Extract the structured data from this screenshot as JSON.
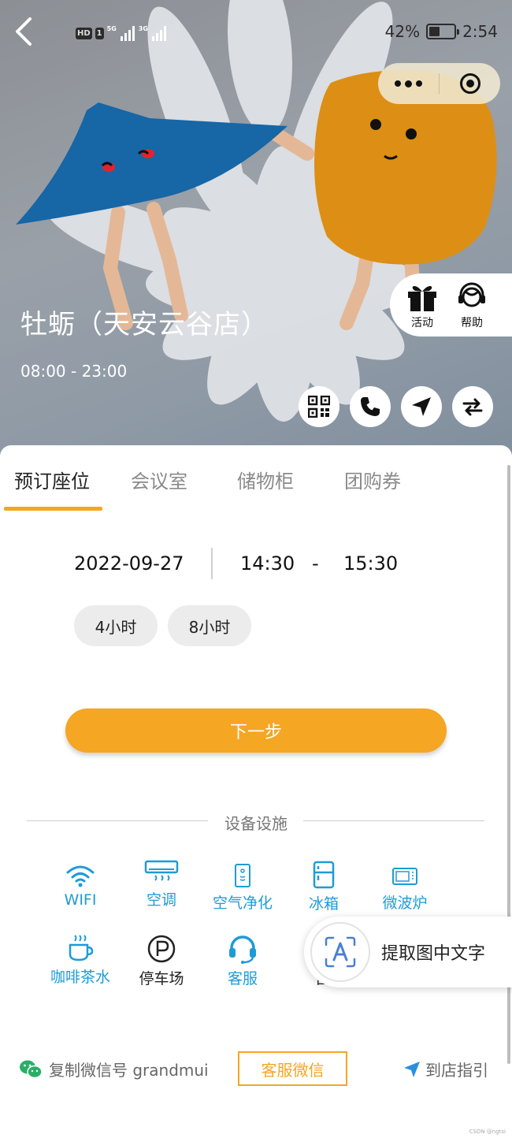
{
  "status_bar": {
    "hd_badge": "HD",
    "sim": "1",
    "net1": "5G",
    "net2": "3G",
    "battery_percent": "42%",
    "battery_level": 0.42,
    "time": "2:54"
  },
  "side_actions": [
    {
      "label": "活动",
      "icon": "gift-icon"
    },
    {
      "label": "帮助",
      "icon": "customer-service-icon"
    }
  ],
  "store": {
    "name": "牡蛎（天安云谷店）",
    "hours": "08:00 - 23:00"
  },
  "quick_actions": [
    {
      "icon": "qrcode-icon"
    },
    {
      "icon": "phone-icon"
    },
    {
      "icon": "navigate-icon"
    },
    {
      "icon": "switch-icon"
    }
  ],
  "tabs": [
    {
      "label": "预订座位",
      "active": true
    },
    {
      "label": "会议室",
      "active": false
    },
    {
      "label": "储物柜",
      "active": false
    },
    {
      "label": "团购券",
      "active": false
    }
  ],
  "booking": {
    "date": "2022-09-27",
    "start_time": "14:30",
    "separator": "-",
    "end_time": "15:30",
    "durations": [
      "4小时",
      "8小时"
    ],
    "next_label": "下一步"
  },
  "facilities": {
    "title": "设备设施",
    "items": [
      {
        "label": "WIFI",
        "icon": "wifi-icon"
      },
      {
        "label": "空调",
        "icon": "air-conditioner-icon"
      },
      {
        "label": "空气净化",
        "icon": "air-purifier-icon"
      },
      {
        "label": "冰箱",
        "icon": "fridge-icon"
      },
      {
        "label": "微波炉",
        "icon": "microwave-icon"
      },
      {
        "label": "咖啡茶水",
        "icon": "coffee-icon"
      },
      {
        "label": "停车场",
        "icon": "parking-icon"
      },
      {
        "label": "客服",
        "icon": "headset-icon"
      },
      {
        "label": "图",
        "icon": "partially-hidden-icon"
      }
    ]
  },
  "ocr_button": {
    "label": "提取图中文字"
  },
  "footer": {
    "copy_wechat": "复制微信号 grandmui",
    "cs_wechat": "客服微信",
    "guide": "到店指引"
  },
  "watermark": "CSDN @ngtsi",
  "colors": {
    "accent": "#f5a623",
    "facility_blue": "#1e9bd7"
  }
}
